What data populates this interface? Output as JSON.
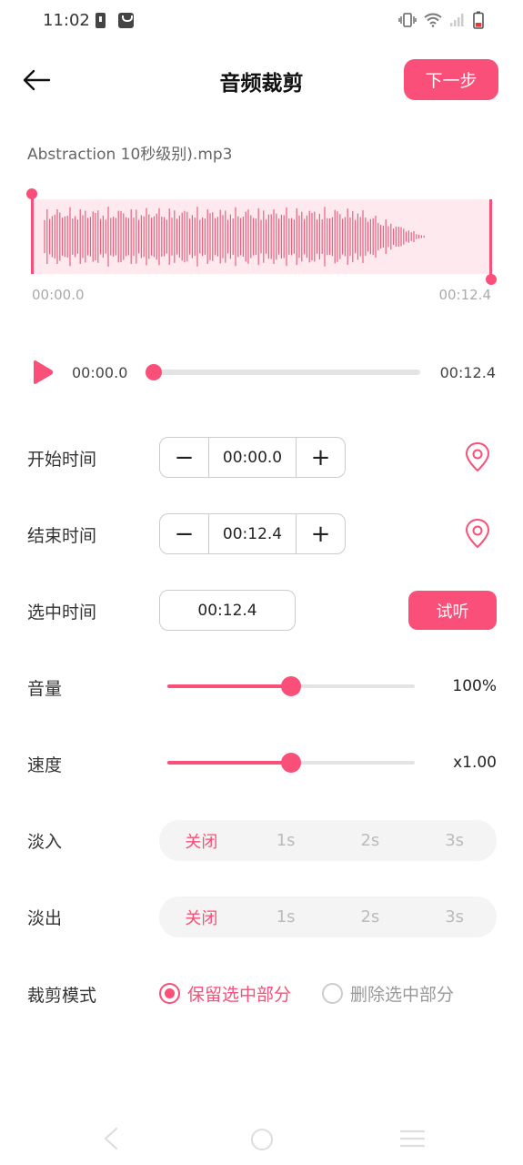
{
  "status_bar": {
    "time": "11:02"
  },
  "header": {
    "title": "音频裁剪",
    "next_label": "下一步"
  },
  "file": {
    "name": "Abstraction 10秒级别).mp3"
  },
  "waveform": {
    "start_label": "00:00.0",
    "end_label": "00:12.4"
  },
  "playback": {
    "current": "00:00.0",
    "total": "00:12.4",
    "progress": 0.0
  },
  "start_time": {
    "label": "开始时间",
    "value": "00:00.0",
    "minus": "−",
    "plus": "+"
  },
  "end_time": {
    "label": "结束时间",
    "value": "00:12.4",
    "minus": "−",
    "plus": "+"
  },
  "selected_time": {
    "label": "选中时间",
    "value": "00:12.4",
    "listen_label": "试听"
  },
  "volume": {
    "label": "音量",
    "value_text": "100%",
    "level": 0.5
  },
  "speed": {
    "label": "速度",
    "value_text": "x1.00",
    "level": 0.5
  },
  "fade_in": {
    "label": "淡入",
    "options": [
      "关闭",
      "1s",
      "2s",
      "3s"
    ],
    "selected": "关闭"
  },
  "fade_out": {
    "label": "淡出",
    "options": [
      "关闭",
      "1s",
      "2s",
      "3s"
    ],
    "selected": "关闭"
  },
  "crop_mode": {
    "label": "裁剪模式",
    "options": [
      "保留选中部分",
      "删除选中部分"
    ],
    "selected": "保留选中部分"
  },
  "colors": {
    "accent": "#f94f78",
    "wave_bg": "#fde9ee"
  }
}
